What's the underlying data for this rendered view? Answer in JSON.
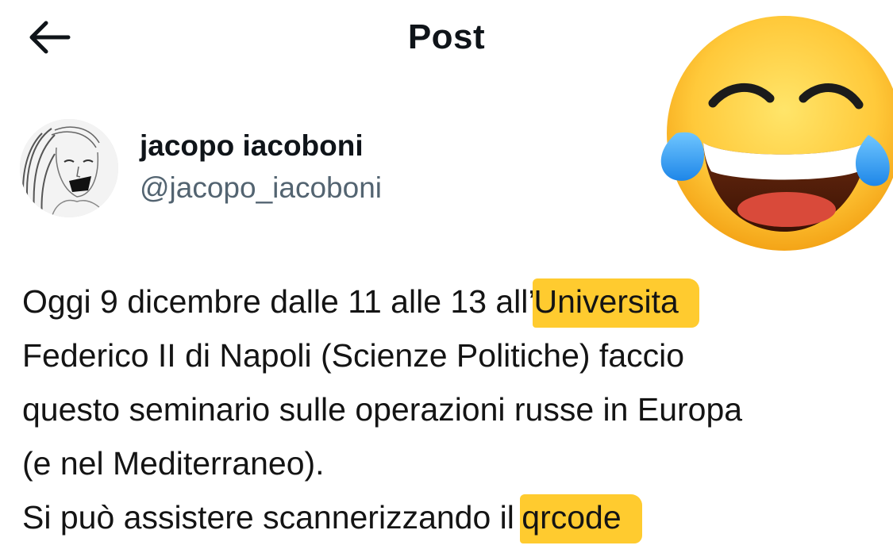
{
  "header": {
    "back_icon": "arrow-left-icon",
    "title": "Post"
  },
  "overlay": {
    "emoji_icon": "face-with-tears-of-joy-icon"
  },
  "author": {
    "display_name": "jacopo iacoboni",
    "handle": "@jacopo_iacoboni"
  },
  "tweet": {
    "lines": [
      {
        "before": "Oggi 9 dicembre dalle 11 alle 13 all’",
        "highlight": "Universita"
      },
      {
        "text": "Federico II di Napoli (Scienze Politiche) faccio"
      },
      {
        "text": "questo seminario sulle operazioni russe in Europa"
      },
      {
        "text": "(e nel Mediterraneo)."
      },
      {
        "before": "Si può assistere scannerizzando il ",
        "highlight": "qrcode"
      }
    ]
  },
  "colors": {
    "highlight": "#ffcb2f",
    "handle_gray": "#536471",
    "text": "#0f1419"
  }
}
